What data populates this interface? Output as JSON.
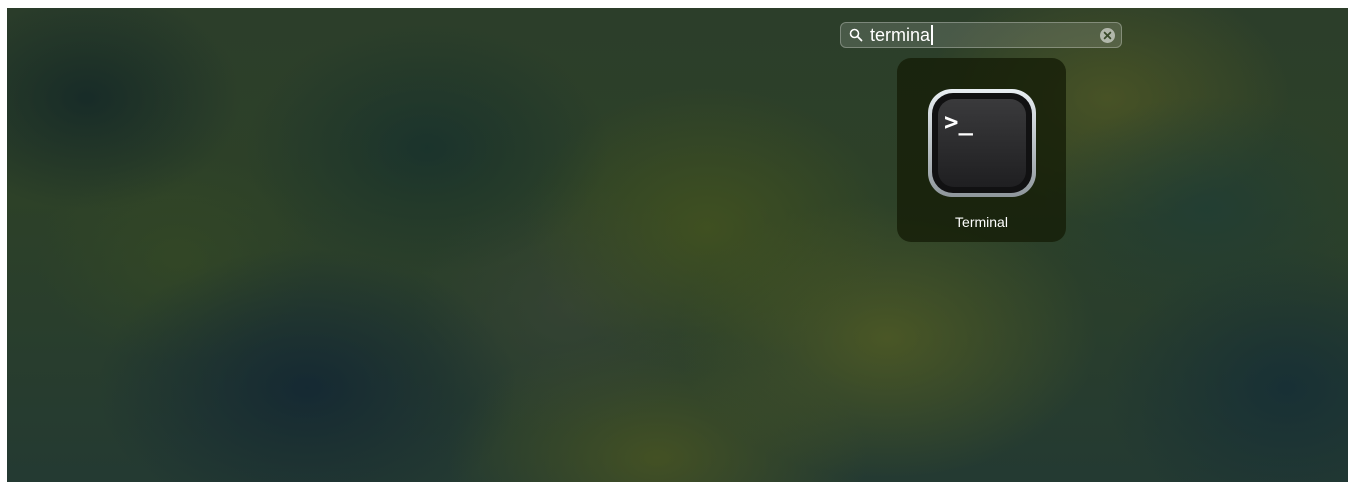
{
  "search": {
    "value": "termina",
    "icon": "magnifying-glass-icon",
    "clear_icon": "clear-circle-x-icon"
  },
  "results": [
    {
      "label": "Terminal",
      "icon": "terminal-app-icon",
      "icon_glyph": ">_"
    }
  ],
  "colors": {
    "wallpaper_base": "#2d4128",
    "tile_background": "#141c06",
    "text": "#ffffff"
  }
}
